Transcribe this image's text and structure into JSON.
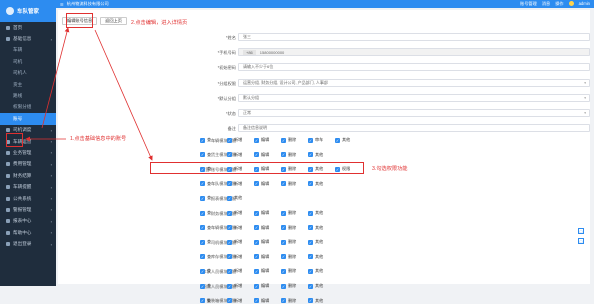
{
  "app": {
    "brand": "车队管家"
  },
  "topbar": {
    "company": "杭州物流科技有限公司",
    "links": [
      "账号管理",
      "消息",
      "操作"
    ],
    "user": "admin"
  },
  "sidebar": {
    "items": [
      {
        "label": "首页",
        "sub": false
      },
      {
        "label": "基础信息",
        "sub": false
      },
      {
        "label": "车辆",
        "sub": true
      },
      {
        "label": "司机",
        "sub": true
      },
      {
        "label": "司机人",
        "sub": true
      },
      {
        "label": "货主",
        "sub": true
      },
      {
        "label": "路线",
        "sub": true
      },
      {
        "label": "权限分组",
        "sub": true
      },
      {
        "label": "账号",
        "sub": true,
        "active": true
      },
      {
        "label": "司机调度",
        "sub": false
      },
      {
        "label": "车辆运营",
        "sub": false
      },
      {
        "label": "业务管理",
        "sub": false
      },
      {
        "label": "费用管理",
        "sub": false
      },
      {
        "label": "财务结算",
        "sub": false
      },
      {
        "label": "车辆提醒",
        "sub": false
      },
      {
        "label": "公共系统",
        "sub": false
      },
      {
        "label": "警报管理",
        "sub": false
      },
      {
        "label": "报表中心",
        "sub": false
      },
      {
        "label": "帮助中心",
        "sub": false
      },
      {
        "label": "退出登录",
        "sub": false
      }
    ]
  },
  "toolbar": {
    "edit_label": "编辑账号信息",
    "back_label": "返回上页"
  },
  "form": {
    "fields": [
      {
        "label": "*姓名",
        "value": "张三",
        "disabled": false
      },
      {
        "label": "*手机号码",
        "prefix": "+86",
        "value": "15800000000",
        "disabled": true
      },
      {
        "label": "*初始密码",
        "value": "请输入不少于6位",
        "disabled": false
      },
      {
        "label": "*分组权限",
        "value": "运营分组, 财务分组, 设计公司, 产品部门, 人事部",
        "disabled": false,
        "select": true
      },
      {
        "label": "*默认分组",
        "value": "默认分组",
        "disabled": false,
        "select": true
      },
      {
        "label": "*状态",
        "value": "正常",
        "disabled": false,
        "select": true
      },
      {
        "label": "备注",
        "value": "备注信息说明",
        "disabled": false
      }
    ]
  },
  "permissions": {
    "rows": [
      {
        "label": "车辆模块权限",
        "opts": [
          "查",
          "新增",
          "编辑",
          "删除",
          "审车",
          "其他"
        ]
      },
      {
        "label": "货主模块权限",
        "opts": [
          "查",
          "新增",
          "编辑",
          "删除",
          "其他"
        ]
      },
      {
        "label": "运营/账号模块权限",
        "opts": [
          "查",
          "新增",
          "编辑",
          "删除",
          "其他",
          "权限"
        ]
      },
      {
        "label": "车队模块权限",
        "opts": [
          "查",
          "新增",
          "编辑",
          "删除",
          "其他"
        ]
      },
      {
        "label": "报表模块权限",
        "opts": [
          "查",
          "其他"
        ]
      },
      {
        "label": "财务模块权限",
        "opts": [
          "查",
          "新增",
          "编辑",
          "删除",
          "其他"
        ]
      },
      {
        "label": "车辆模块权限",
        "opts": [
          "查",
          "新增",
          "编辑",
          "删除",
          "其他"
        ]
      },
      {
        "label": "司机模块权限",
        "opts": [
          "查",
          "新增",
          "编辑",
          "删除",
          "其他"
        ]
      },
      {
        "label": "库存模块权限",
        "opts": [
          "查",
          "新增",
          "编辑",
          "删除",
          "其他"
        ]
      },
      {
        "label": "车队人员模块权限",
        "opts": [
          "查",
          "新增",
          "编辑",
          "删除",
          "其他"
        ]
      },
      {
        "label": "网点人员模块权限",
        "opts": [
          "查",
          "新增",
          "编辑",
          "删除",
          "其他"
        ]
      },
      {
        "label": "集装箱模块权限",
        "opts": [
          "查",
          "新增",
          "编辑",
          "删除",
          "其他"
        ]
      }
    ]
  },
  "annotations": {
    "step1": "1.点击基础信息中的账号",
    "step2": "2.点击编辑，进入详情页",
    "step3": "3.勾选权限功能"
  },
  "colors": {
    "accent": "#2d8cf0",
    "sidebar": "#1f2d3d",
    "annotation": "#e03030"
  }
}
